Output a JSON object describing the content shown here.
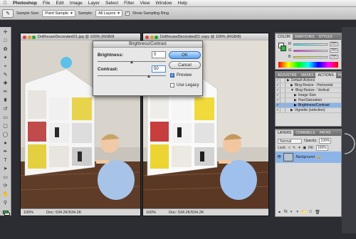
{
  "menubar": {
    "apple": "",
    "items": [
      "Photoshop",
      "File",
      "Edit",
      "Image",
      "Layer",
      "Select",
      "Filter",
      "View",
      "Window",
      "Help"
    ]
  },
  "options": {
    "sample_size_label": "Sample Size:",
    "sample_size_value": "Point Sample",
    "sample_label": "Sample:",
    "sample_value": "All Layers",
    "sampling_ring_label": "Show Sampling Ring"
  },
  "documents": [
    {
      "title": "DollhouseDecorated21.jpg @ 100% (RGB/8",
      "zoom": "100%",
      "doc_info": "Doc: 534.2K/534.2K"
    },
    {
      "title": "DollhouseDecorated21 copy @ 100% (RGB/8)",
      "zoom": "100%",
      "doc_info": "Doc: 534.2K/534.2K"
    }
  ],
  "dialog": {
    "title": "Brightness/Contrast",
    "brightness_label": "Brightness:",
    "brightness_value": "0",
    "contrast_label": "Contrast:",
    "contrast_value": "50",
    "brightness_level": 0,
    "contrast_level": 50,
    "ok": "OK",
    "cancel": "Cancel",
    "preview": "Preview",
    "preview_checked": true,
    "use_legacy": "Use Legacy",
    "use_legacy_checked": false
  },
  "color_panel": {
    "tabs": [
      "COLOR",
      "SWATCHES",
      "STYLES"
    ],
    "channels": [
      {
        "label": "R",
        "value": "255"
      },
      {
        "label": "G",
        "value": "255"
      },
      {
        "label": "B",
        "value": "255"
      }
    ]
  },
  "actions_panel": {
    "tabs": [
      "ADJUSTME",
      "MASKS",
      "ACTIONS",
      "HISTORY"
    ],
    "items": [
      {
        "label": "Default Actions",
        "level": 0,
        "expanded": false
      },
      {
        "label": "Blog Resize - Horizontal",
        "level": 1,
        "expanded": false
      },
      {
        "label": "Blog Resize - Vertical",
        "level": 1,
        "expanded": true
      },
      {
        "label": "Image Size",
        "level": 2,
        "expanded": false
      },
      {
        "label": "Hue/Saturation",
        "level": 2,
        "expanded": false
      },
      {
        "label": "Brightness/Contrast",
        "level": 2,
        "expanded": false,
        "selected": true
      },
      {
        "label": "Vignette (selection)",
        "level": 1,
        "expanded": false
      }
    ]
  },
  "layers_panel": {
    "tabs": [
      "LAYERS",
      "CHANNELS",
      "PATHS"
    ],
    "blend_mode": "Normal",
    "opacity_label": "Opacity:",
    "opacity_value": "100%",
    "lock_label": "Lock:",
    "fill_label": "Fill:",
    "fill_value": "100%",
    "layer_name": "Background"
  },
  "colors": {
    "accent": "#4a8ae0",
    "fg_swatch": "#2fb63d"
  }
}
